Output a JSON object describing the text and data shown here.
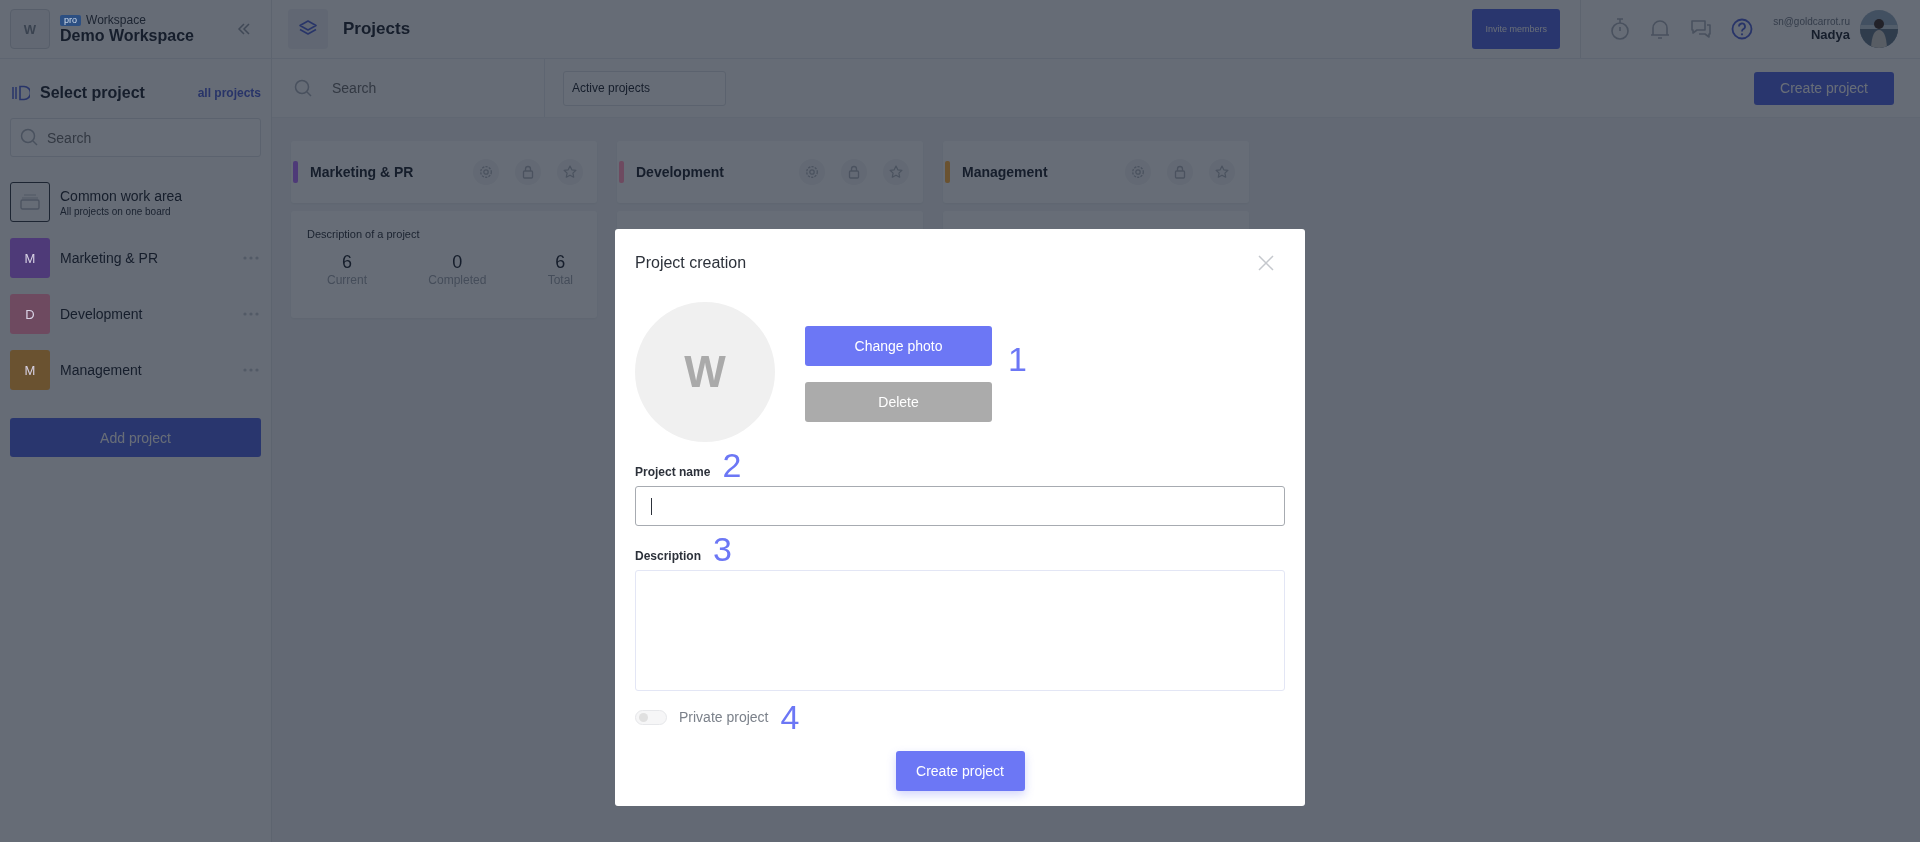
{
  "workspace": {
    "logo_letter": "W",
    "badge": "pro",
    "label": "Workspace",
    "name": "Demo Workspace"
  },
  "sidebar": {
    "title": "Select project",
    "link": "all projects",
    "search": {
      "placeholder": "Search"
    },
    "items": [
      {
        "kind": "board",
        "name": "Common work area",
        "subtitle": "All projects on one board"
      },
      {
        "kind": "project",
        "letter": "M",
        "name": "Marketing & PR",
        "color": "#4e3a78"
      },
      {
        "kind": "project",
        "letter": "D",
        "name": "Development",
        "color": "#6e4a60"
      },
      {
        "kind": "project",
        "letter": "M",
        "name": "Management",
        "color": "#6a5230"
      }
    ],
    "add_button": "Add project"
  },
  "header": {
    "title": "Projects",
    "invite_button": "Invite members",
    "user": {
      "email": "sn@goldcarrot.ru",
      "name": "Nadya"
    }
  },
  "toolbar": {
    "search": {
      "placeholder": "Search"
    },
    "filter": "Active projects",
    "create_button": "Create project"
  },
  "projects": [
    {
      "name": "Marketing & PR",
      "color": "#4e3a78",
      "description": "Description of a project",
      "stats": [
        {
          "value": "6",
          "label": "Current"
        },
        {
          "value": "0",
          "label": "Completed"
        },
        {
          "value": "6",
          "label": "Total"
        }
      ]
    },
    {
      "name": "Development",
      "color": "#6e4a60"
    },
    {
      "name": "Management",
      "color": "#6a5230"
    }
  ],
  "dialog": {
    "title": "Project creation",
    "avatar_letter": "W",
    "change_photo_button": "Change photo",
    "delete_button": "Delete",
    "marker_photo": "1",
    "name_label": "Project name",
    "marker_name": "2",
    "name_field": {
      "focused": true
    },
    "description_label": "Description",
    "marker_description": "3",
    "private_toggle": {
      "label": "Private project",
      "on": false
    },
    "marker_private": "4",
    "create_button": "Create project"
  }
}
